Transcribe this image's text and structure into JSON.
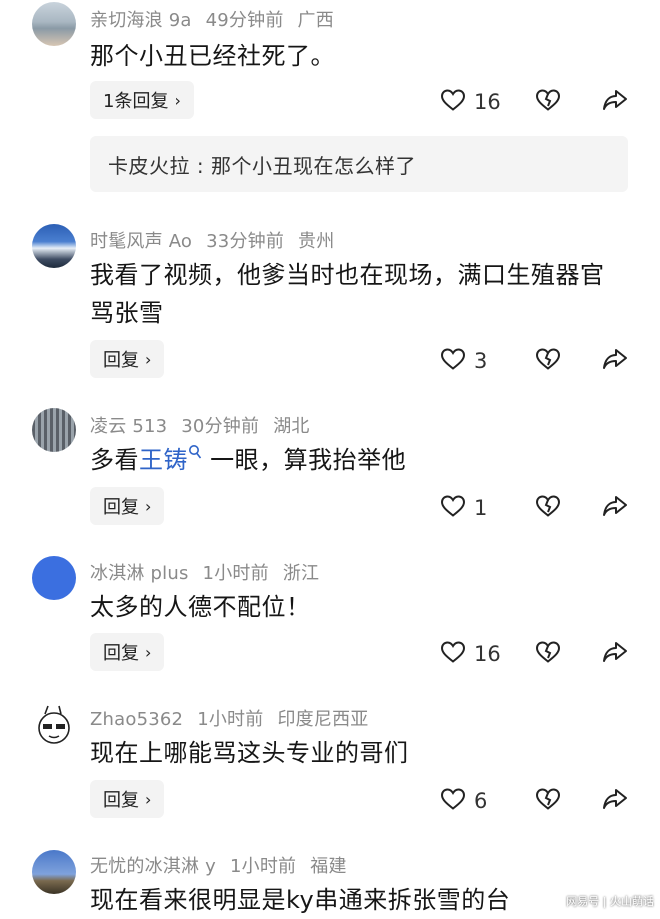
{
  "comments": [
    {
      "username": "亲切海浪 9a",
      "time": "49分钟前",
      "location": "广西",
      "text": "那个小丑已经社死了。",
      "reply_label": "1条回复",
      "likes": "16",
      "sub_reply": "卡皮火拉 : 那个小丑现在怎么样了"
    },
    {
      "username": "时髦风声 Ao",
      "time": "33分钟前",
      "location": "贵州",
      "text_line1": "我看了视频，他爹当时也在现场，满口生殖器官",
      "text_line2": "骂张雪",
      "reply_label": "回复",
      "likes": "3"
    },
    {
      "username": "凌云 513",
      "time": "30分钟前",
      "location": "湖北",
      "text_before": "多看",
      "text_link": "王铸",
      "text_after": "一眼，算我抬举他",
      "reply_label": "回复",
      "likes": "1"
    },
    {
      "username": "冰淇淋 plus",
      "time": "1小时前",
      "location": "浙江",
      "text": "太多的人德不配位！",
      "reply_label": "回复",
      "likes": "16"
    },
    {
      "username": "Zhao5362",
      "time": "1小时前",
      "location": "印度尼西亚",
      "text": "现在上哪能骂这头专业的哥们",
      "reply_label": "回复",
      "likes": "6"
    },
    {
      "username": "无忧的冰淇淋 y",
      "time": "1小时前",
      "location": "福建",
      "text": "现在看来很明显是ky串通来拆张雪的台"
    }
  ],
  "icons": {
    "like": "heart-outline-icon",
    "dislike": "broken-heart-icon",
    "share": "share-arrow-icon",
    "search": "search-icon",
    "chevron": "chevron-right-icon"
  },
  "chevron_glyph": "›",
  "watermark": "网易号 | 火山萌话",
  "colors": {
    "link": "#2f64c8",
    "meta": "#8a8a8a",
    "reply_bg": "#f3f3f3"
  }
}
